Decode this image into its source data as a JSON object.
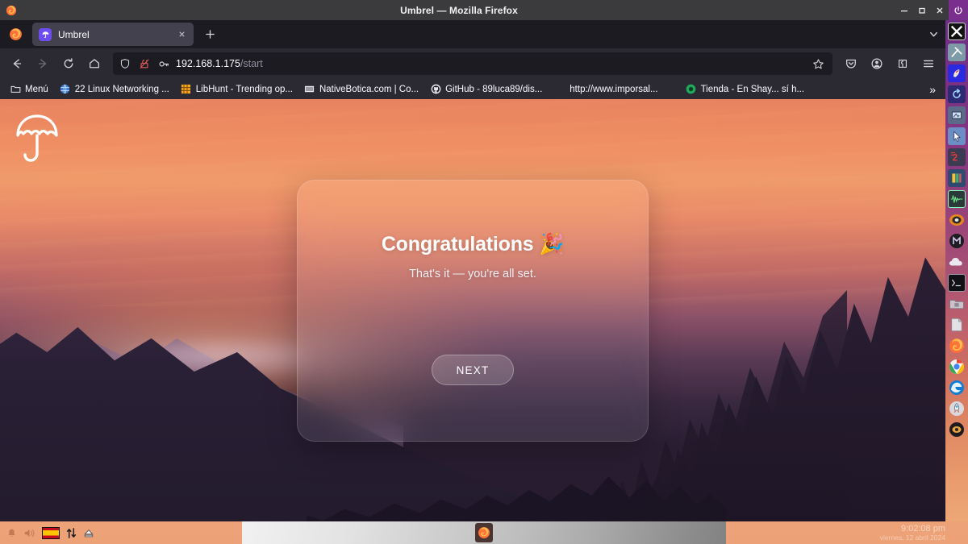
{
  "titlebar": {
    "title": "Umbrel — Mozilla Firefox",
    "minimize": "—",
    "maximize": "▢",
    "close": "✕",
    "power_icon": "power-icon",
    "app_icon": "firefox-icon"
  },
  "browser": {
    "tab": {
      "title": "Umbrel",
      "favicon": "umbrel-favicon",
      "close_label": "✕"
    },
    "new_tab_label": "+",
    "list_all_tabs_icon": "chevron-down-icon",
    "nav": {
      "back_icon": "back-arrow-icon",
      "forward_icon": "forward-arrow-icon",
      "reload_icon": "reload-icon",
      "home_icon": "home-icon"
    },
    "urlbar": {
      "shield_icon": "shield-icon",
      "lock_icon": "broken-lock-icon",
      "key_icon": "key-icon",
      "host": "192.168.1.175",
      "path": "/start",
      "value": "192.168.1.175/start",
      "bookmark_icon": "star-icon"
    },
    "toolbar_right": {
      "pocket_icon": "save-to-pocket-icon",
      "account_icon": "account-icon",
      "extensions_icon": "extensions-icon",
      "menu_icon": "hamburger-menu-icon"
    },
    "bookmarks": [
      {
        "label": "Menú",
        "icon": "folder-icon"
      },
      {
        "label": "22 Linux Networking ...",
        "icon": "globe-icon"
      },
      {
        "label": "LibHunt - Trending op...",
        "icon": "libhunt-icon"
      },
      {
        "label": "NativeBotica.com | Co...",
        "icon": "nativebotica-icon"
      },
      {
        "label": "GitHub - 89luca89/dis...",
        "icon": "github-icon"
      },
      {
        "label": "http://www.imporsal...",
        "icon": "none"
      },
      {
        "label": "Tienda - En Shay... sí h...",
        "icon": "tienda-icon"
      }
    ],
    "bookmarks_overflow": "»"
  },
  "page": {
    "logo": "umbrel-umbrella-logo",
    "card": {
      "title": "Congratulations 🎉",
      "subtitle": "That's it — you're all set.",
      "next_button": "NEXT"
    }
  },
  "dock": {
    "items": [
      {
        "name": "xterm-icon",
        "glyph": "✕"
      },
      {
        "name": "tools-icon",
        "glyph": "⚒"
      },
      {
        "name": "gimp-icon",
        "glyph": "🖌"
      },
      {
        "name": "restore-icon",
        "glyph": "↺"
      },
      {
        "name": "screenshot-icon",
        "glyph": "▣"
      },
      {
        "name": "cursor-icon",
        "glyph": "➤"
      },
      {
        "name": "xnview-icon",
        "glyph": "2"
      },
      {
        "name": "editor-icon",
        "glyph": "▤"
      },
      {
        "name": "audacity-icon",
        "glyph": "〜"
      },
      {
        "name": "vlc-icon",
        "glyph": "◎"
      },
      {
        "name": "media-icon",
        "glyph": "◍"
      },
      {
        "name": "cloud-icon",
        "glyph": "☁"
      },
      {
        "name": "terminal-icon",
        "glyph": "▪"
      },
      {
        "name": "file-manager-icon",
        "glyph": "▭"
      },
      {
        "name": "documents-icon",
        "glyph": "▯"
      },
      {
        "name": "firefox-icon",
        "glyph": "◔"
      },
      {
        "name": "chrome-icon",
        "glyph": "◉"
      },
      {
        "name": "edge-icon",
        "glyph": "◎"
      },
      {
        "name": "rocket-icon",
        "glyph": "🚀"
      },
      {
        "name": "app-icon",
        "glyph": "◑"
      }
    ]
  },
  "taskbar": {
    "tray": {
      "bell_icon": "bell-icon",
      "volume_icon": "volume-icon",
      "keyboard_layout": "spain-flag-icon",
      "network_icon": "network-updown-icon",
      "eject_icon": "eject-icon"
    },
    "window_button": {
      "icon": "firefox-icon"
    },
    "clock": {
      "time": "9:02:08 pm",
      "date": "viernes, 12 abril 2024"
    }
  }
}
